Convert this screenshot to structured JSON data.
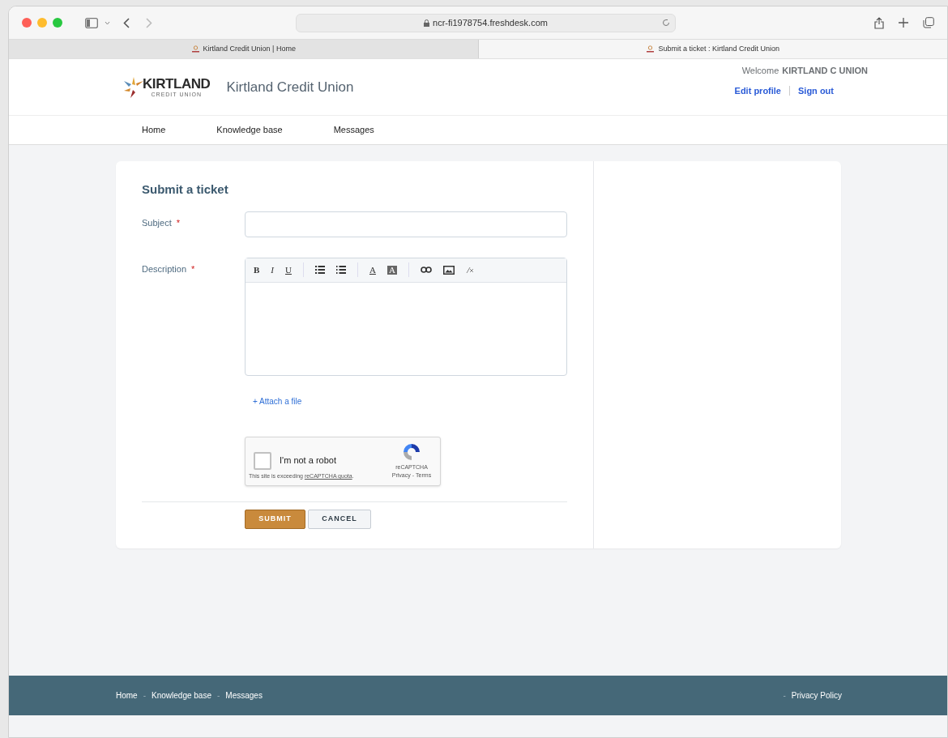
{
  "browser": {
    "url": "ncr-fi1978754.freshdesk.com",
    "tabs": [
      {
        "title": "Kirtland Credit Union | Home",
        "selected": false
      },
      {
        "title": "Submit a ticket : Kirtland Credit Union",
        "selected": true
      }
    ]
  },
  "header": {
    "logo_word": "KIRTLAND",
    "logo_sub": "CREDIT UNION",
    "site_name": "Kirtland Credit Union",
    "welcome": "Welcome",
    "user": "KIRTLAND C UNION",
    "links": [
      "Edit profile",
      "Sign out"
    ]
  },
  "nav": [
    "Home",
    "Knowledge base",
    "Messages"
  ],
  "form": {
    "title": "Submit a ticket",
    "fields": [
      {
        "label": "Subject",
        "required_mark": "*",
        "kind": "input"
      },
      {
        "label": "Description",
        "required_mark": "*",
        "kind": "editor"
      }
    ],
    "editor_tools": [
      {
        "kind": "bold",
        "label": "B"
      },
      {
        "kind": "italic",
        "label": "I"
      },
      {
        "kind": "underline",
        "label": "U"
      },
      {
        "kind": "sep"
      },
      {
        "kind": "bullets"
      },
      {
        "kind": "numbers"
      },
      {
        "kind": "sep"
      },
      {
        "kind": "color",
        "label": "A"
      },
      {
        "kind": "highlight",
        "label": "A"
      },
      {
        "kind": "sep"
      },
      {
        "kind": "link"
      },
      {
        "kind": "image"
      },
      {
        "kind": "clear"
      }
    ],
    "attach": "+ Attach a file",
    "captcha": {
      "checked": false,
      "label": "I'm not a robot",
      "note": "This site is exceeding",
      "note_link": "reCAPTCHA quota",
      "note_end": ".",
      "brand": "reCAPTCHA",
      "privacy": "Privacy",
      "dash": "-",
      "terms": "Terms"
    },
    "buttons": [
      {
        "label": "SUBMIT",
        "kind": "primary"
      },
      {
        "label": "CANCEL",
        "kind": "secondary"
      }
    ]
  },
  "footer": {
    "links": [
      {
        "label": "Home"
      },
      {
        "sep": "-",
        "label": "Knowledge base"
      },
      {
        "sep": "-",
        "label": "Messages"
      }
    ],
    "right_sep": "-",
    "right": "Privacy Policy"
  }
}
